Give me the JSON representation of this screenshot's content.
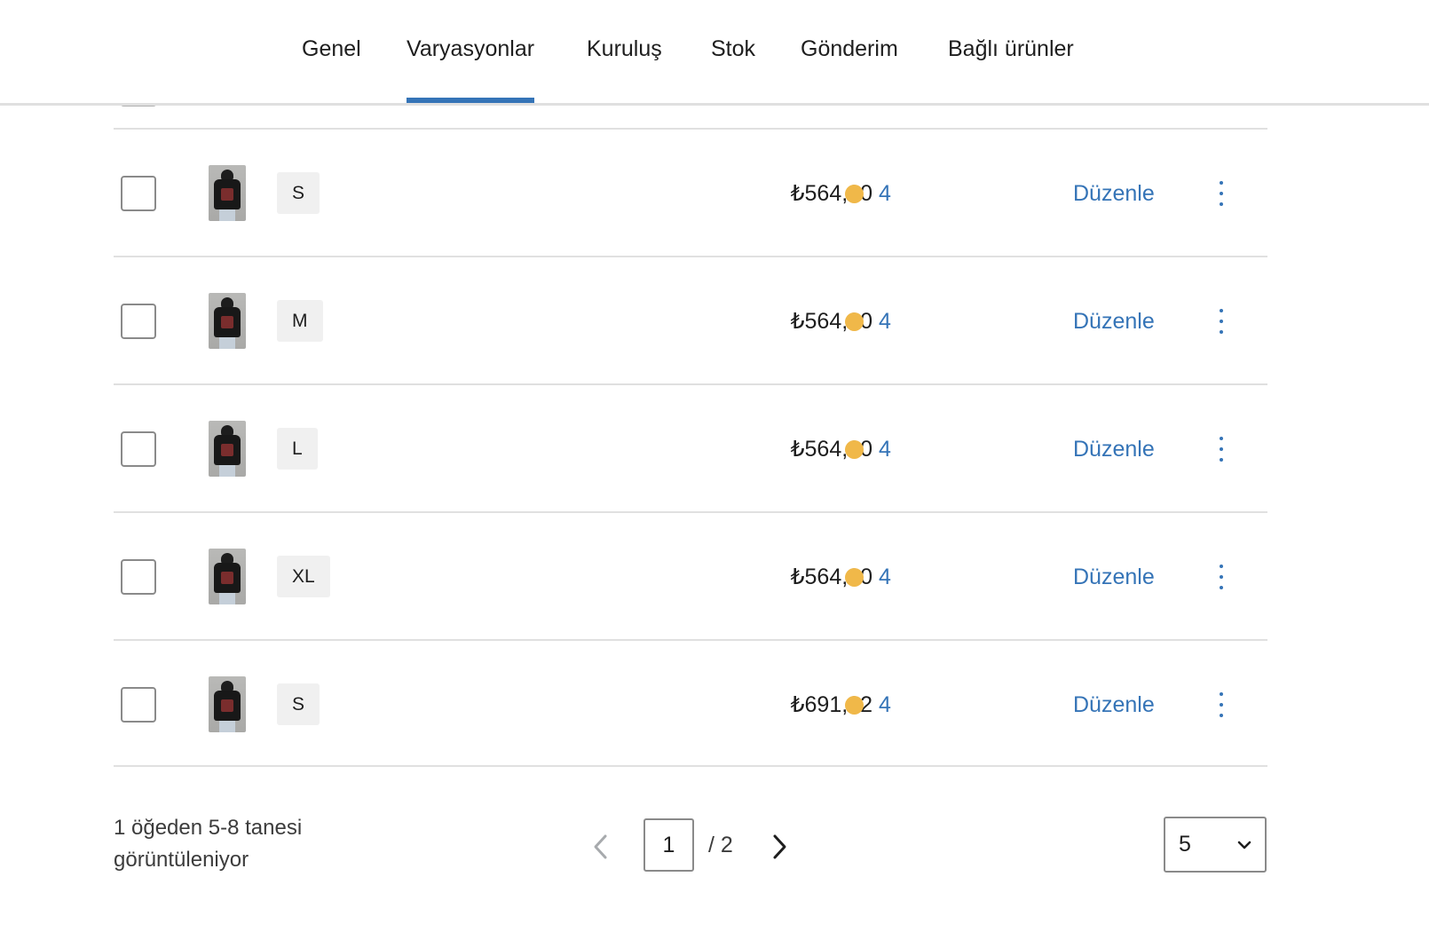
{
  "tabs": [
    {
      "label": "Genel",
      "active": false
    },
    {
      "label": "Varyasyonlar",
      "active": true
    },
    {
      "label": "Kuruluş",
      "active": false
    },
    {
      "label": "Stok",
      "active": false
    },
    {
      "label": "Gönderim",
      "active": false
    },
    {
      "label": "Bağlı ürünler",
      "active": false
    }
  ],
  "variations": [
    {
      "attribute": "S",
      "price": "₺564,30",
      "stock": "4",
      "edit_label": "Düzenle"
    },
    {
      "attribute": "M",
      "price": "₺564,30",
      "stock": "4",
      "edit_label": "Düzenle"
    },
    {
      "attribute": "L",
      "price": "₺564,30",
      "stock": "4",
      "edit_label": "Düzenle"
    },
    {
      "attribute": "XL",
      "price": "₺564,30",
      "stock": "4",
      "edit_label": "Düzenle"
    },
    {
      "attribute": "S",
      "price": "₺691,02",
      "stock": "4",
      "edit_label": "Düzenle"
    }
  ],
  "footer": {
    "summary": "1 öğeden 5-8 tanesi görüntüleniyor",
    "current_page": "1",
    "total_pages": "/ 2",
    "per_page": "5"
  },
  "colors": {
    "accent": "#3574b7",
    "stock_dot": "#f0b849"
  },
  "icons": {
    "prev": "chevron-left-icon",
    "next": "chevron-right-icon",
    "dropdown": "chevron-down-icon",
    "more": "more-vertical-icon"
  }
}
